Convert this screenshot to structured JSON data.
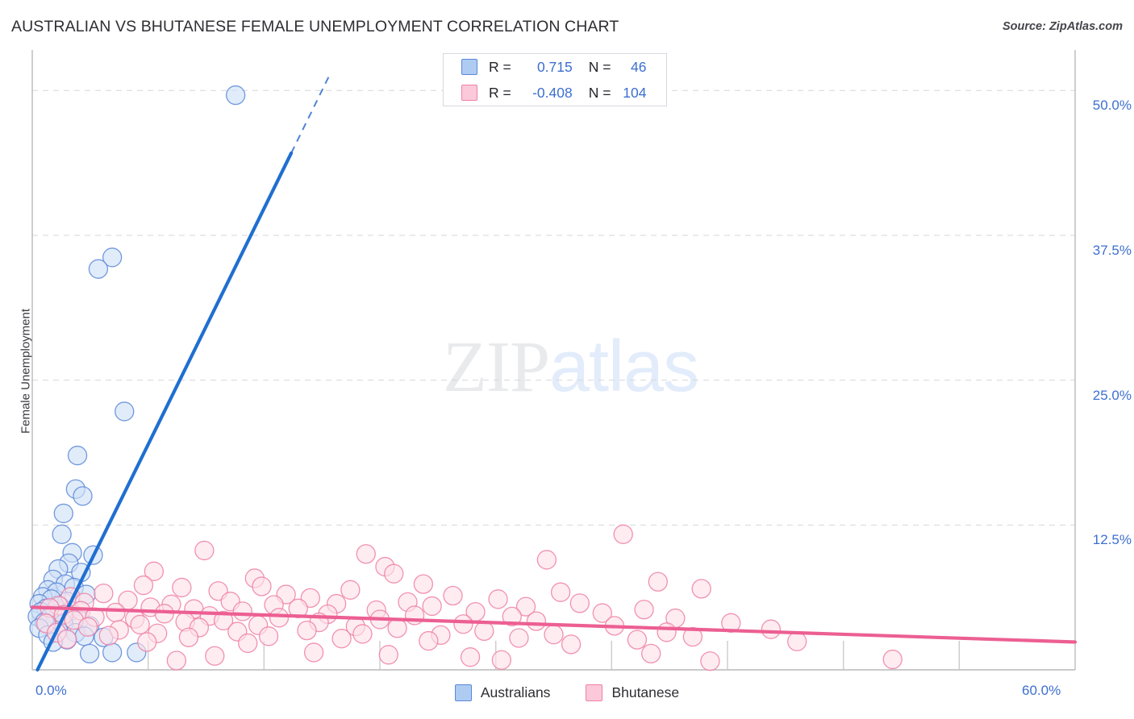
{
  "header": {
    "title": "AUSTRALIAN VS BHUTANESE FEMALE UNEMPLOYMENT CORRELATION CHART",
    "source": "Source: ZipAtlas.com"
  },
  "watermark": {
    "part1": "ZIP",
    "part2": "atlas"
  },
  "stats": {
    "rows": [
      {
        "series": "Australians",
        "r_label": "R =",
        "r_value": "0.715",
        "n_label": "N =",
        "n_value": "46",
        "color": "#aecbf2"
      },
      {
        "series": "Bhutanese",
        "r_label": "R =",
        "r_value": "-0.408",
        "n_label": "N =",
        "n_value": "104",
        "color": "#fbc9d9"
      }
    ]
  },
  "legend": {
    "position": "bottom-center",
    "items": [
      {
        "label": "Australians",
        "color": "#aecbf2",
        "border": "#5b87d8"
      },
      {
        "label": "Bhutanese",
        "color": "#fbc9d9",
        "border": "#ef7fa5"
      }
    ]
  },
  "chart_data": {
    "type": "scatter",
    "title": "AUSTRALIAN VS BHUTANESE FEMALE UNEMPLOYMENT CORRELATION CHART",
    "xlabel": "",
    "ylabel": "Female Unemployment",
    "xlim": [
      0,
      60
    ],
    "ylim": [
      0,
      53.5
    ],
    "grid": "horizontal-dashed",
    "x_ticks": [
      {
        "value": 0,
        "label": "0.0%"
      },
      {
        "value": 60,
        "label": "60.0%"
      }
    ],
    "x_tick_marks": [
      0,
      6.67,
      13.33,
      20,
      26.67,
      33.33,
      40,
      46.67,
      53.33,
      60
    ],
    "y_ticks": [
      {
        "value": 12.5,
        "label": "12.5%"
      },
      {
        "value": 25.0,
        "label": "25.0%"
      },
      {
        "value": 37.5,
        "label": "37.5%"
      },
      {
        "value": 50.0,
        "label": "50.0%"
      }
    ],
    "series": [
      {
        "name": "Australians",
        "r": 0.715,
        "n": 46,
        "fill": "#cfe0f7",
        "stroke": "#5b87d8",
        "trendline": {
          "x0": 0.3,
          "y0": 0.0,
          "x1": 14.9,
          "y1": 44.6,
          "solid_to_y": 44.6,
          "dashed_to_y": 51.5
        },
        "points": [
          [
            11.7,
            49.6
          ],
          [
            4.6,
            35.6
          ],
          [
            3.8,
            34.6
          ],
          [
            5.3,
            22.3
          ],
          [
            2.6,
            18.5
          ],
          [
            2.5,
            15.6
          ],
          [
            2.9,
            15.0
          ],
          [
            1.8,
            13.5
          ],
          [
            1.7,
            11.7
          ],
          [
            2.3,
            10.1
          ],
          [
            3.5,
            9.9
          ],
          [
            2.1,
            9.2
          ],
          [
            1.5,
            8.7
          ],
          [
            2.8,
            8.4
          ],
          [
            1.2,
            7.8
          ],
          [
            1.9,
            7.4
          ],
          [
            2.4,
            7.1
          ],
          [
            0.9,
            6.9
          ],
          [
            1.4,
            6.7
          ],
          [
            3.1,
            6.5
          ],
          [
            0.6,
            6.3
          ],
          [
            1.1,
            6.1
          ],
          [
            2.0,
            5.9
          ],
          [
            0.4,
            5.7
          ],
          [
            1.6,
            5.5
          ],
          [
            0.8,
            5.3
          ],
          [
            2.2,
            5.1
          ],
          [
            0.5,
            5.0
          ],
          [
            1.3,
            4.8
          ],
          [
            0.3,
            4.6
          ],
          [
            1.0,
            4.5
          ],
          [
            2.7,
            4.3
          ],
          [
            0.7,
            4.1
          ],
          [
            1.8,
            4.0
          ],
          [
            3.3,
            3.8
          ],
          [
            0.4,
            3.6
          ],
          [
            1.5,
            3.4
          ],
          [
            2.5,
            3.2
          ],
          [
            0.9,
            3.0
          ],
          [
            3.0,
            2.9
          ],
          [
            4.1,
            2.8
          ],
          [
            2.0,
            2.6
          ],
          [
            1.2,
            2.4
          ],
          [
            4.6,
            1.5
          ],
          [
            6.0,
            1.5
          ],
          [
            3.3,
            1.4
          ]
        ]
      },
      {
        "name": "Bhutanese",
        "r": -0.408,
        "n": 104,
        "fill": "#fde0e9",
        "stroke": "#ef7fa5",
        "trendline": {
          "x0": 0.0,
          "y0": 5.4,
          "x1": 60.0,
          "y1": 2.4
        },
        "points": [
          [
            34.0,
            11.7
          ],
          [
            9.9,
            10.3
          ],
          [
            19.2,
            10.0
          ],
          [
            29.6,
            9.5
          ],
          [
            20.3,
            8.9
          ],
          [
            7.0,
            8.5
          ],
          [
            20.8,
            8.3
          ],
          [
            12.8,
            7.9
          ],
          [
            36.0,
            7.6
          ],
          [
            22.5,
            7.4
          ],
          [
            6.4,
            7.3
          ],
          [
            13.2,
            7.2
          ],
          [
            8.6,
            7.1
          ],
          [
            38.5,
            7.0
          ],
          [
            18.3,
            6.9
          ],
          [
            10.7,
            6.8
          ],
          [
            30.4,
            6.7
          ],
          [
            4.1,
            6.6
          ],
          [
            14.6,
            6.5
          ],
          [
            24.2,
            6.4
          ],
          [
            2.2,
            6.3
          ],
          [
            16.0,
            6.2
          ],
          [
            26.8,
            6.1
          ],
          [
            5.5,
            6.0
          ],
          [
            11.4,
            5.9
          ],
          [
            21.6,
            5.85
          ],
          [
            3.0,
            5.8
          ],
          [
            31.5,
            5.75
          ],
          [
            17.5,
            5.7
          ],
          [
            8.0,
            5.65
          ],
          [
            13.9,
            5.6
          ],
          [
            1.5,
            5.55
          ],
          [
            23.0,
            5.5
          ],
          [
            28.4,
            5.45
          ],
          [
            6.8,
            5.4
          ],
          [
            1.0,
            5.35
          ],
          [
            15.3,
            5.3
          ],
          [
            9.3,
            5.25
          ],
          [
            35.2,
            5.2
          ],
          [
            19.8,
            5.15
          ],
          [
            2.8,
            5.1
          ],
          [
            12.1,
            5.05
          ],
          [
            25.5,
            5.0
          ],
          [
            4.8,
            4.95
          ],
          [
            32.8,
            4.9
          ],
          [
            7.6,
            4.85
          ],
          [
            17.0,
            4.8
          ],
          [
            1.8,
            4.75
          ],
          [
            22.0,
            4.7
          ],
          [
            10.2,
            4.65
          ],
          [
            27.6,
            4.6
          ],
          [
            3.6,
            4.55
          ],
          [
            14.2,
            4.5
          ],
          [
            37.0,
            4.45
          ],
          [
            5.9,
            4.4
          ],
          [
            20.0,
            4.35
          ],
          [
            2.4,
            4.3
          ],
          [
            11.0,
            4.25
          ],
          [
            29.0,
            4.2
          ],
          [
            8.8,
            4.15
          ],
          [
            16.5,
            4.1
          ],
          [
            40.2,
            4.05
          ],
          [
            0.8,
            4.0
          ],
          [
            24.8,
            3.95
          ],
          [
            6.2,
            3.9
          ],
          [
            13.0,
            3.85
          ],
          [
            33.5,
            3.8
          ],
          [
            18.6,
            3.75
          ],
          [
            3.2,
            3.7
          ],
          [
            9.6,
            3.65
          ],
          [
            21.0,
            3.6
          ],
          [
            42.5,
            3.5
          ],
          [
            5.0,
            3.45
          ],
          [
            15.8,
            3.4
          ],
          [
            26.0,
            3.35
          ],
          [
            11.8,
            3.3
          ],
          [
            36.5,
            3.25
          ],
          [
            1.4,
            3.2
          ],
          [
            7.2,
            3.15
          ],
          [
            19.0,
            3.1
          ],
          [
            30.0,
            3.05
          ],
          [
            23.5,
            3.0
          ],
          [
            4.4,
            2.95
          ],
          [
            13.6,
            2.9
          ],
          [
            38.0,
            2.85
          ],
          [
            9.0,
            2.8
          ],
          [
            28.0,
            2.75
          ],
          [
            17.8,
            2.7
          ],
          [
            2.0,
            2.65
          ],
          [
            34.8,
            2.6
          ],
          [
            22.8,
            2.5
          ],
          [
            44.0,
            2.45
          ],
          [
            6.6,
            2.4
          ],
          [
            12.4,
            2.3
          ],
          [
            31.0,
            2.2
          ],
          [
            16.2,
            1.5
          ],
          [
            35.6,
            1.4
          ],
          [
            20.5,
            1.3
          ],
          [
            10.5,
            1.2
          ],
          [
            25.2,
            1.1
          ],
          [
            49.5,
            0.9
          ],
          [
            27.0,
            0.85
          ],
          [
            8.3,
            0.8
          ],
          [
            39.0,
            0.75
          ]
        ]
      }
    ]
  }
}
